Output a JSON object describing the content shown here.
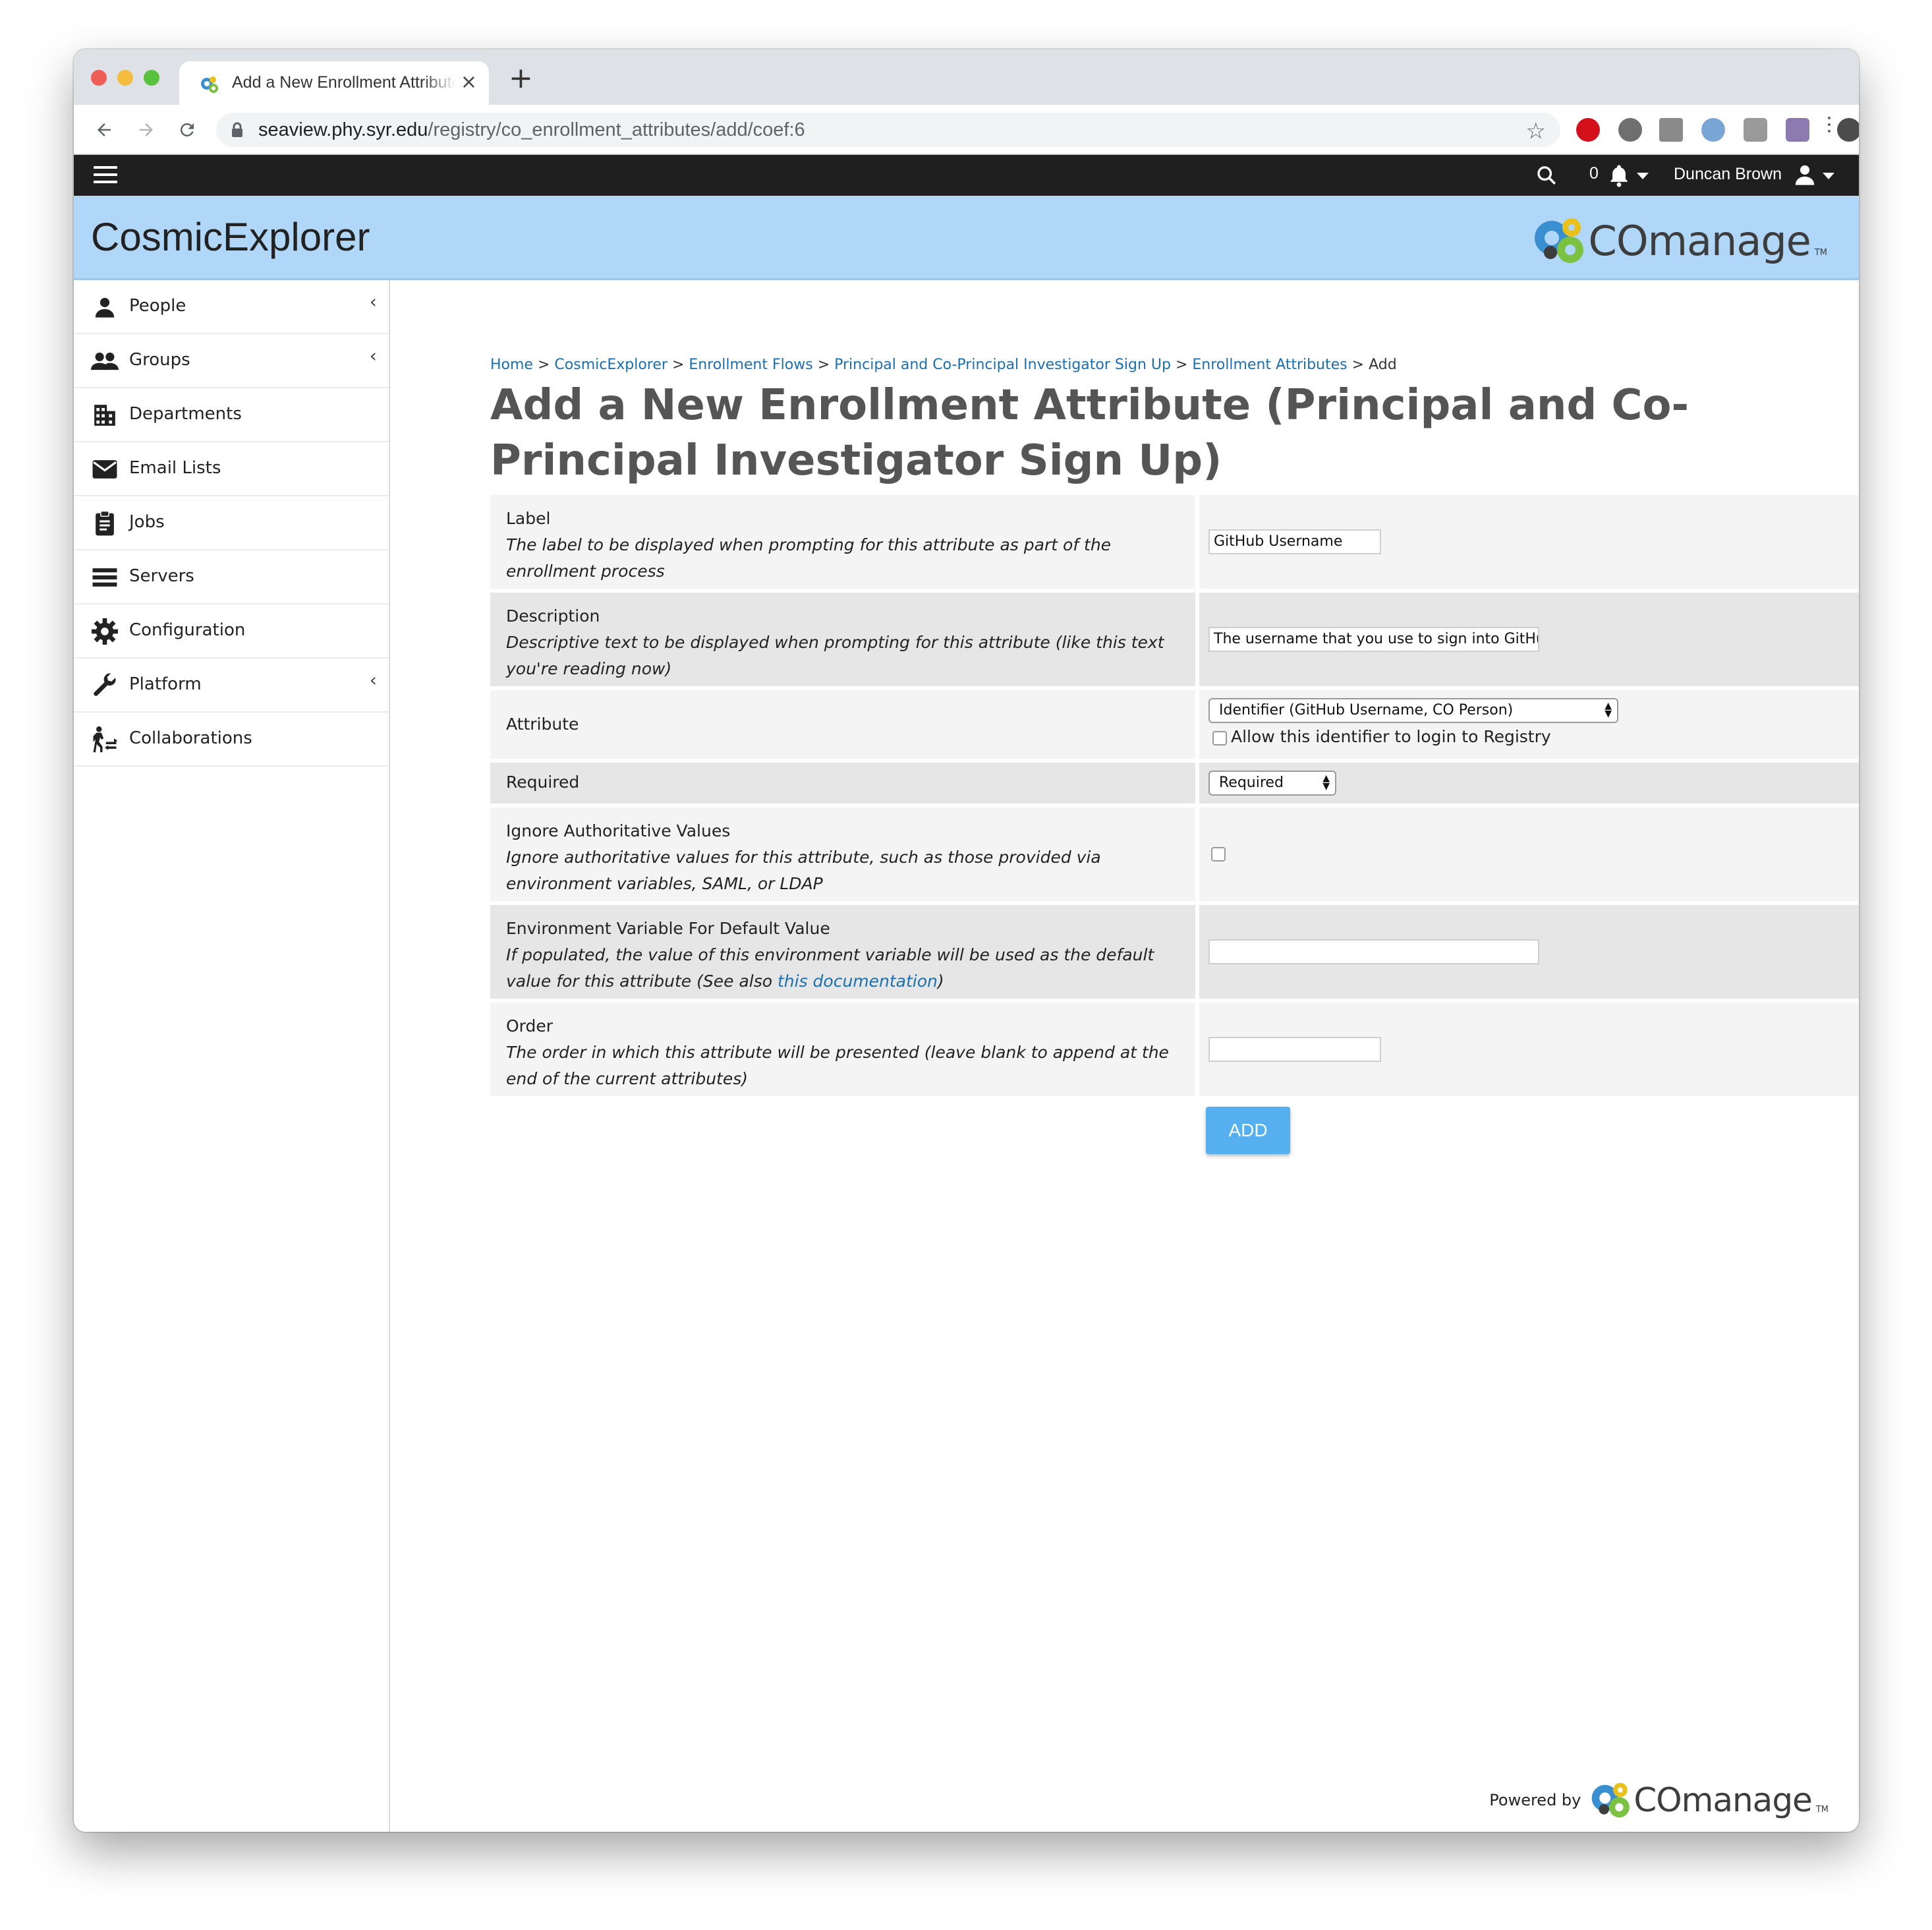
{
  "browser": {
    "tab_title": "Add a New Enrollment Attribute (Principal and Co-Principal Investigator Sign Up)",
    "tab_close": "×",
    "new_tab": "+",
    "url_host": "seaview.phy.syr.edu",
    "url_path": "/registry/co_enrollment_attributes/add/coef:6",
    "extensions": [
      "adblock-icon",
      "extension-icon",
      "drive-icon",
      "extension-icon",
      "extension-icon",
      "extension-icon"
    ]
  },
  "appbar": {
    "notification_count": "0",
    "user_name": "Duncan Brown"
  },
  "header": {
    "app_title": "CosmicExplorer",
    "brand": "COmanage",
    "brand_tm": "TM"
  },
  "sidebar": {
    "items": [
      {
        "label": "People",
        "icon": "person-icon",
        "has_chevron": true
      },
      {
        "label": "Groups",
        "icon": "group-icon",
        "has_chevron": true
      },
      {
        "label": "Departments",
        "icon": "building-icon",
        "has_chevron": false
      },
      {
        "label": "Email Lists",
        "icon": "envelope-icon",
        "has_chevron": false
      },
      {
        "label": "Jobs",
        "icon": "clipboard-icon",
        "has_chevron": false
      },
      {
        "label": "Servers",
        "icon": "server-icon",
        "has_chevron": false
      },
      {
        "label": "Configuration",
        "icon": "gear-icon",
        "has_chevron": false
      },
      {
        "label": "Platform",
        "icon": "wrench-icon",
        "has_chevron": true
      },
      {
        "label": "Collaborations",
        "icon": "collaborations-icon",
        "has_chevron": false
      }
    ],
    "chevron": "‹"
  },
  "breadcrumb": {
    "items": [
      "Home",
      "CosmicExplorer",
      "Enrollment Flows",
      "Principal and Co-Principal Investigator Sign Up",
      "Enrollment Attributes"
    ],
    "current": "Add",
    "separator": ">"
  },
  "page": {
    "title": "Add a New Enrollment Attribute (Principal and Co-Principal Investigator Sign Up)"
  },
  "form": {
    "label": {
      "title": "Label",
      "desc": "The label to be displayed when prompting for this attribute as part of the enrollment process",
      "value": "GitHub Username"
    },
    "description": {
      "title": "Description",
      "desc": "Descriptive text to be displayed when prompting for this attribute (like this text you're reading now)",
      "value": "The username that you use to sign into GitHub"
    },
    "attribute": {
      "title": "Attribute",
      "selected": "Identifier (GitHub Username, CO Person)",
      "login_checkbox_label": "Allow this identifier to login to Registry",
      "login_checked": false
    },
    "required": {
      "title": "Required",
      "selected": "Required"
    },
    "ignore_authoritative": {
      "title": "Ignore Authoritative Values",
      "desc": "Ignore authoritative values for this attribute, such as those provided via environment variables, SAML, or LDAP",
      "checked": false
    },
    "env_variable": {
      "title": "Environment Variable For Default Value",
      "desc_prefix": "If populated, the value of this environment variable will be used as the default value for this attribute (See also ",
      "desc_link": "this documentation",
      "desc_suffix": ")",
      "value": ""
    },
    "order": {
      "title": "Order",
      "desc": "The order in which this attribute will be presented (leave blank to append at the end of the current attributes)",
      "value": ""
    },
    "submit_label": "ADD"
  },
  "footer": {
    "powered_by": "Powered by",
    "brand": "COmanage",
    "brand_tm": "TM"
  }
}
